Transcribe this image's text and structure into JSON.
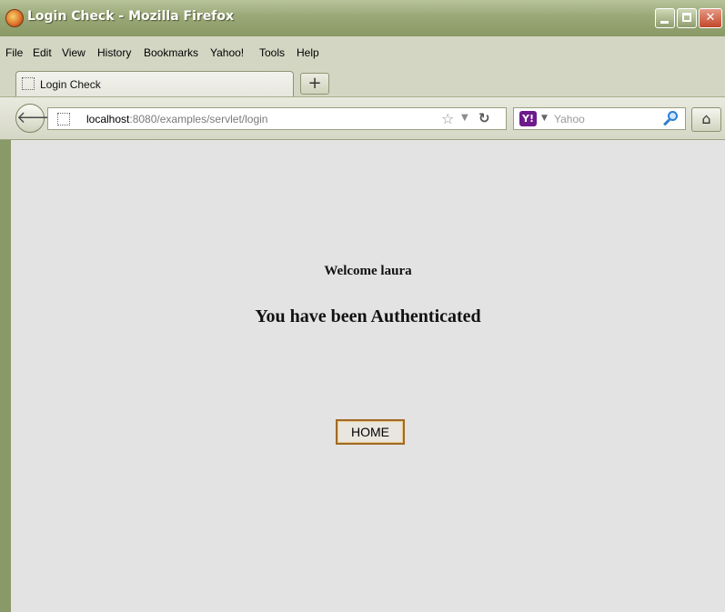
{
  "window": {
    "title": "Login Check - Mozilla Firefox",
    "controls": {
      "minimize": "minimize-icon",
      "maximize": "maximize-icon",
      "close": "close-icon"
    }
  },
  "menubar": {
    "items": [
      {
        "label": "File"
      },
      {
        "label": "Edit"
      },
      {
        "label": "View"
      },
      {
        "label": "History"
      },
      {
        "label": "Bookmarks"
      },
      {
        "label": "Yahoo!"
      },
      {
        "label": "Tools"
      },
      {
        "label": "Help"
      }
    ]
  },
  "tabs": {
    "active": {
      "label": "Login Check"
    },
    "new_tab_label": "+"
  },
  "navbar": {
    "url_host": "localhost",
    "url_path": ":8080/examples/servlet/login",
    "search_engine_badge": "Y!",
    "search_placeholder": "Yahoo",
    "icons": [
      "back-icon",
      "site-icon",
      "star-icon",
      "reload-icon",
      "search-icon",
      "home-icon"
    ]
  },
  "page": {
    "welcome_text": "Welcome laura",
    "auth_text": "You have been Authenticated",
    "home_button_label": "HOME"
  },
  "colors": {
    "titlebar": "#9aa877",
    "content_bg": "#e3e3e3",
    "button_border": "#a06a26"
  }
}
